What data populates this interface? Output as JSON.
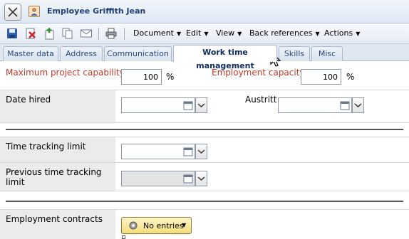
{
  "window": {
    "title": "Employee Griffith Jean"
  },
  "toolbar": {
    "menus": [
      {
        "label": "Document"
      },
      {
        "label": "Edit"
      },
      {
        "label": "View"
      },
      {
        "label": "Back references"
      },
      {
        "label": "Actions"
      }
    ]
  },
  "tabs": [
    {
      "label": "Master data",
      "active": false
    },
    {
      "label": "Address",
      "active": false
    },
    {
      "label": "Communication",
      "active": false
    },
    {
      "label": "Work time management",
      "active": true
    },
    {
      "label": "Skills",
      "active": false
    },
    {
      "label": "Misc",
      "active": false
    }
  ],
  "form": {
    "max_capability": {
      "label": "Maximum project capability",
      "value": "100",
      "unit": "%"
    },
    "employment_capacity": {
      "label": "Employment capacity",
      "value": "100",
      "unit": "%"
    },
    "date_hired": {
      "label": "Date hired",
      "value": ""
    },
    "austritt": {
      "label": "Austritt",
      "value": ""
    },
    "time_tracking_limit": {
      "label": "Time tracking limit",
      "value": ""
    },
    "previous_time_tracking_limit": {
      "label": "Previous time tracking limit",
      "value": ""
    },
    "employment_contracts": {
      "label": "Employment contracts",
      "button_label": "No entries"
    }
  },
  "colors": {
    "required_label": "#c0392b",
    "title": "#1d3f7a",
    "tab_active": "#ffffff"
  }
}
